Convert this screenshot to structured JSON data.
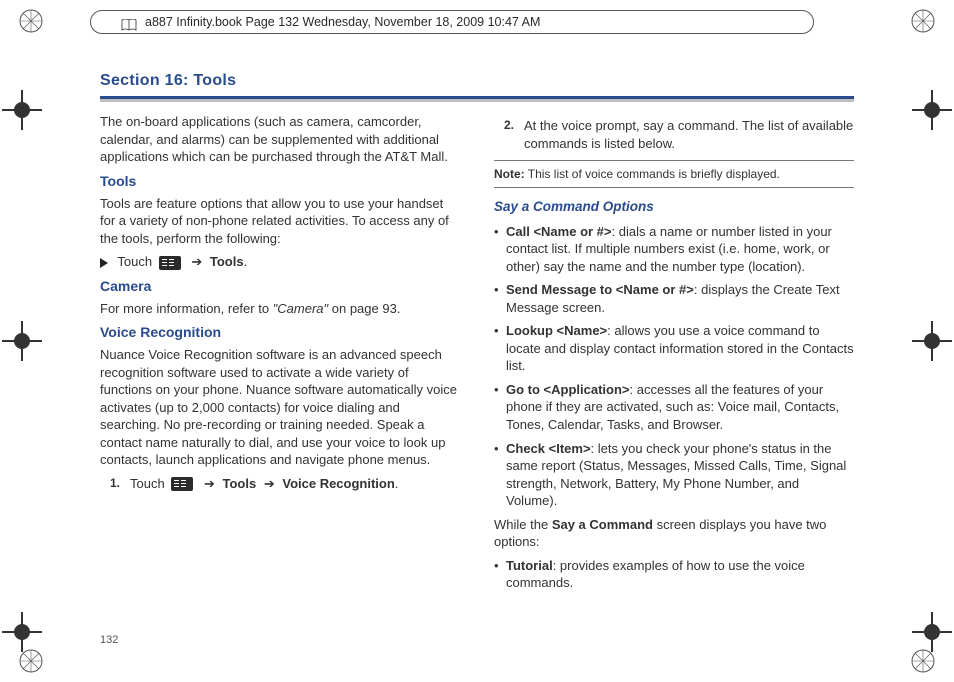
{
  "header": {
    "text": "a887 Infinity.book  Page 132  Wednesday, November 18, 2009  10:47 AM"
  },
  "title": "Section 16: Tools",
  "page_number": "132",
  "left": {
    "intro": "The on-board applications (such as camera, camcorder, calendar, and alarms) can be supplemented with additional applications which can be purchased through the AT&T Mall.",
    "tools_head": "Tools",
    "tools_body": "Tools are feature options that allow you to use your handset for a variety of non-phone related activities. To access any of the tools, perform the following:",
    "touch_label": "Touch",
    "tools_bold": "Tools",
    "camera_head": "Camera",
    "camera_body_pre": "For more information, refer to ",
    "camera_ref": "\"Camera\"",
    "camera_body_post": "  on page 93.",
    "voice_head": "Voice Recognition",
    "voice_body": "Nuance Voice Recognition software is an advanced speech recognition software used to activate a wide variety of functions on your phone. Nuance software automatically voice activates (up to 2,000 contacts) for voice dialing and searching. No pre-recording or training needed. Speak a contact name naturally to dial, and use your voice to look up contacts, launch applications and navigate phone menus.",
    "step1_num": "1.",
    "step1_touch": "Touch",
    "step1_tools": "Tools",
    "step1_voice": "Voice Recognition"
  },
  "right": {
    "step2_num": "2.",
    "step2_body": "At the voice prompt, say a command. The list of available commands is listed below.",
    "note_label": "Note:",
    "note_body": " This list of voice commands is briefly displayed.",
    "say_head": "Say a Command Options",
    "b1_bold": "Call <Name or #>",
    "b1_rest": ": dials a name or number listed in your contact list. If multiple numbers exist (i.e. home, work, or other) say the name and the number type (location).",
    "b2_bold": "Send Message to <Name or #>",
    "b2_rest": ": displays the Create Text Message screen.",
    "b3_bold": "Lookup <Name>",
    "b3_rest": ": allows you use a voice command to locate and display contact information stored in the Contacts list.",
    "b4_bold": "Go to <Application>",
    "b4_rest": ": accesses all the features of your phone if they are activated, such as: Voice mail, Contacts, Tones, Calendar, Tasks, and Browser.",
    "b5_bold": "Check <Item>",
    "b5_rest": ": lets you check your phone's status in the same report (Status, Messages, Missed Calls, Time, Signal strength, Network, Battery, My Phone Number, and Volume).",
    "while_pre": "While the ",
    "while_bold": "Say a Command",
    "while_post": " screen displays you have two options:",
    "b6_bold": "Tutorial",
    "b6_rest": ": provides examples of how to use the voice commands."
  },
  "arrow": "➔",
  "period": "."
}
